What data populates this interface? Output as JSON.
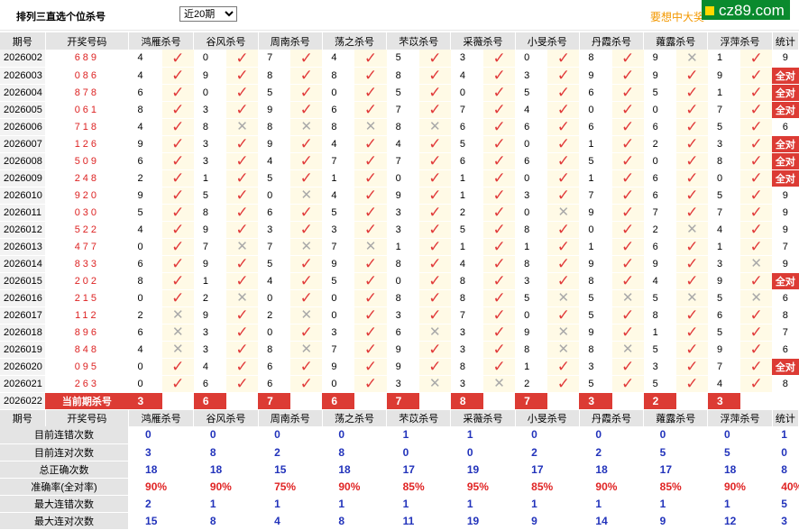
{
  "header": {
    "title": "排列三直选个位杀号",
    "period_select": "近20期",
    "period_options": [
      "近20期"
    ],
    "promo": "要想中大奖",
    "brand": "cz89.com"
  },
  "columns": {
    "issue": "期号",
    "draw": "开奖号码",
    "experts": [
      "鸿雁杀号",
      "谷风杀号",
      "周南杀号",
      "荡之杀号",
      "芣苡杀号",
      "采薇杀号",
      "小旻杀号",
      "丹霞杀号",
      "蕹露杀号",
      "浮萍杀号"
    ],
    "stat": "统计",
    "all_right_label": "全对"
  },
  "rows": [
    {
      "issue": "2026002",
      "draw": "689",
      "kills": [
        "4",
        "0",
        "7",
        "4",
        "5",
        "3",
        "0",
        "8",
        "9",
        "1"
      ],
      "ok": [
        1,
        1,
        1,
        1,
        1,
        1,
        1,
        1,
        0,
        1
      ],
      "stat": "9"
    },
    {
      "issue": "2026003",
      "draw": "086",
      "kills": [
        "4",
        "9",
        "8",
        "8",
        "8",
        "4",
        "3",
        "9",
        "9",
        "9"
      ],
      "ok": [
        1,
        1,
        1,
        1,
        1,
        1,
        1,
        1,
        1,
        1
      ],
      "stat": "全对"
    },
    {
      "issue": "2026004",
      "draw": "878",
      "kills": [
        "6",
        "0",
        "5",
        "0",
        "5",
        "0",
        "5",
        "6",
        "5",
        "1"
      ],
      "ok": [
        1,
        1,
        1,
        1,
        1,
        1,
        1,
        1,
        1,
        1
      ],
      "stat": "全对"
    },
    {
      "issue": "2026005",
      "draw": "061",
      "kills": [
        "8",
        "3",
        "9",
        "6",
        "7",
        "7",
        "4",
        "0",
        "0",
        "7"
      ],
      "ok": [
        1,
        1,
        1,
        1,
        1,
        1,
        1,
        1,
        1,
        1
      ],
      "stat": "全对"
    },
    {
      "issue": "2026006",
      "draw": "718",
      "kills": [
        "4",
        "8",
        "8",
        "8",
        "8",
        "6",
        "6",
        "6",
        "6",
        "5"
      ],
      "ok": [
        1,
        0,
        0,
        0,
        0,
        1,
        1,
        1,
        1,
        1
      ],
      "stat": "6"
    },
    {
      "issue": "2026007",
      "draw": "126",
      "kills": [
        "9",
        "3",
        "9",
        "4",
        "4",
        "5",
        "0",
        "1",
        "2",
        "3"
      ],
      "ok": [
        1,
        1,
        1,
        1,
        1,
        1,
        1,
        1,
        1,
        1
      ],
      "stat": "全对"
    },
    {
      "issue": "2026008",
      "draw": "509",
      "kills": [
        "6",
        "3",
        "4",
        "7",
        "7",
        "6",
        "6",
        "5",
        "0",
        "8"
      ],
      "ok": [
        1,
        1,
        1,
        1,
        1,
        1,
        1,
        1,
        1,
        1
      ],
      "stat": "全对"
    },
    {
      "issue": "2026009",
      "draw": "248",
      "kills": [
        "2",
        "1",
        "5",
        "1",
        "0",
        "1",
        "0",
        "1",
        "6",
        "0"
      ],
      "ok": [
        1,
        1,
        1,
        1,
        1,
        1,
        1,
        1,
        1,
        1
      ],
      "stat": "全对"
    },
    {
      "issue": "2026010",
      "draw": "920",
      "kills": [
        "9",
        "5",
        "0",
        "4",
        "9",
        "1",
        "3",
        "7",
        "6",
        "5"
      ],
      "ok": [
        1,
        1,
        0,
        1,
        1,
        1,
        1,
        1,
        1,
        1
      ],
      "stat": "9"
    },
    {
      "issue": "2026011",
      "draw": "030",
      "kills": [
        "5",
        "8",
        "6",
        "5",
        "3",
        "2",
        "0",
        "9",
        "7",
        "7"
      ],
      "ok": [
        1,
        1,
        1,
        1,
        1,
        1,
        0,
        1,
        1,
        1
      ],
      "stat": "9"
    },
    {
      "issue": "2026012",
      "draw": "522",
      "kills": [
        "4",
        "9",
        "3",
        "3",
        "3",
        "5",
        "8",
        "0",
        "2",
        "4"
      ],
      "ok": [
        1,
        1,
        1,
        1,
        1,
        1,
        1,
        1,
        0,
        1
      ],
      "stat": "9"
    },
    {
      "issue": "2026013",
      "draw": "477",
      "kills": [
        "0",
        "7",
        "7",
        "7",
        "1",
        "1",
        "1",
        "1",
        "6",
        "1"
      ],
      "ok": [
        1,
        0,
        0,
        0,
        1,
        1,
        1,
        1,
        1,
        1
      ],
      "stat": "7"
    },
    {
      "issue": "2026014",
      "draw": "833",
      "kills": [
        "6",
        "9",
        "5",
        "9",
        "8",
        "4",
        "8",
        "9",
        "9",
        "3"
      ],
      "ok": [
        1,
        1,
        1,
        1,
        1,
        1,
        1,
        1,
        1,
        0
      ],
      "stat": "9"
    },
    {
      "issue": "2026015",
      "draw": "202",
      "kills": [
        "8",
        "1",
        "4",
        "5",
        "0",
        "8",
        "3",
        "8",
        "4",
        "9"
      ],
      "ok": [
        1,
        1,
        1,
        1,
        1,
        1,
        1,
        1,
        1,
        1
      ],
      "stat": "全对"
    },
    {
      "issue": "2026016",
      "draw": "215",
      "kills": [
        "0",
        "2",
        "0",
        "0",
        "8",
        "8",
        "5",
        "5",
        "5",
        "5"
      ],
      "ok": [
        1,
        0,
        1,
        1,
        1,
        1,
        0,
        0,
        0,
        0
      ],
      "stat": "6"
    },
    {
      "issue": "2026017",
      "draw": "112",
      "kills": [
        "2",
        "9",
        "2",
        "0",
        "3",
        "7",
        "0",
        "5",
        "8",
        "6"
      ],
      "ok": [
        0,
        1,
        0,
        1,
        1,
        1,
        1,
        1,
        1,
        1
      ],
      "stat": "8"
    },
    {
      "issue": "2026018",
      "draw": "896",
      "kills": [
        "6",
        "3",
        "0",
        "3",
        "6",
        "3",
        "9",
        "9",
        "1",
        "5"
      ],
      "ok": [
        0,
        1,
        1,
        1,
        0,
        1,
        0,
        1,
        1,
        1
      ],
      "stat": "7"
    },
    {
      "issue": "2026019",
      "draw": "848",
      "kills": [
        "4",
        "3",
        "8",
        "7",
        "9",
        "3",
        "8",
        "8",
        "5",
        "9"
      ],
      "ok": [
        0,
        1,
        0,
        1,
        1,
        1,
        0,
        0,
        1,
        1
      ],
      "stat": "6"
    },
    {
      "issue": "2026020",
      "draw": "095",
      "kills": [
        "0",
        "4",
        "6",
        "9",
        "9",
        "8",
        "1",
        "3",
        "3",
        "7"
      ],
      "ok": [
        1,
        1,
        1,
        1,
        1,
        1,
        1,
        1,
        1,
        1
      ],
      "stat": "全对"
    },
    {
      "issue": "2026021",
      "draw": "263",
      "kills": [
        "0",
        "6",
        "6",
        "0",
        "3",
        "3",
        "2",
        "5",
        "5",
        "4"
      ],
      "ok": [
        1,
        1,
        1,
        1,
        0,
        0,
        1,
        1,
        1,
        1
      ],
      "stat": "8"
    }
  ],
  "current": {
    "issue": "2026022",
    "label": "当前期杀号",
    "kills": [
      "3",
      "6",
      "7",
      "6",
      "7",
      "8",
      "7",
      "3",
      "2",
      "3"
    ]
  },
  "stats": [
    {
      "label": "目前连错次数",
      "color": "blue",
      "values": [
        "0",
        "0",
        "0",
        "0",
        "1",
        "1",
        "0",
        "0",
        "0",
        "0"
      ],
      "stat": "1"
    },
    {
      "label": "目前连对次数",
      "color": "blue",
      "values": [
        "3",
        "8",
        "2",
        "8",
        "0",
        "0",
        "2",
        "2",
        "5",
        "5"
      ],
      "stat": "0"
    },
    {
      "label": "总正确次数",
      "color": "blue",
      "values": [
        "18",
        "18",
        "15",
        "18",
        "17",
        "19",
        "17",
        "18",
        "17",
        "18"
      ],
      "stat": "8"
    },
    {
      "label": "准确率(全对率)",
      "color": "red",
      "values": [
        "90%",
        "90%",
        "75%",
        "90%",
        "85%",
        "95%",
        "85%",
        "90%",
        "85%",
        "90%"
      ],
      "stat": "40%"
    },
    {
      "label": "最大连错次数",
      "color": "blue",
      "values": [
        "2",
        "1",
        "1",
        "1",
        "1",
        "1",
        "1",
        "1",
        "1",
        "1"
      ],
      "stat": "5"
    },
    {
      "label": "最大连对次数",
      "color": "blue",
      "values": [
        "15",
        "8",
        "4",
        "8",
        "11",
        "19",
        "9",
        "14",
        "9",
        "12"
      ],
      "stat": "3"
    }
  ]
}
